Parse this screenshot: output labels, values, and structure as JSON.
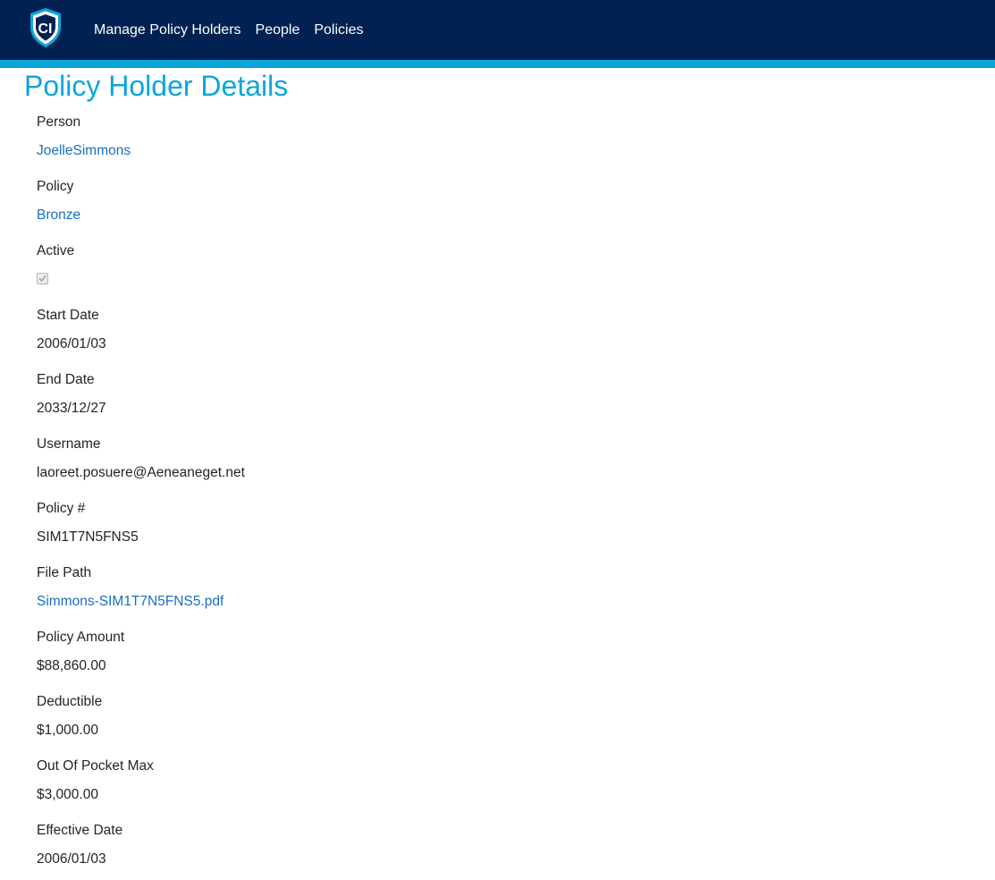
{
  "nav": {
    "logo_text": "CI",
    "links": [
      "Manage Policy Holders",
      "People",
      "Policies"
    ]
  },
  "page": {
    "title": "Policy Holder Details"
  },
  "fields": [
    {
      "label": "Person",
      "value": "JoelleSimmons",
      "type": "link"
    },
    {
      "label": "Policy",
      "value": "Bronze",
      "type": "link"
    },
    {
      "label": "Active",
      "value": true,
      "type": "checkbox"
    },
    {
      "label": "Start Date",
      "value": "2006/01/03",
      "type": "text"
    },
    {
      "label": "End Date",
      "value": "2033/12/27",
      "type": "text"
    },
    {
      "label": "Username",
      "value": "laoreet.posuere@Aeneaneget.net",
      "type": "text"
    },
    {
      "label": "Policy #",
      "value": "SIM1T7N5FNS5",
      "type": "text"
    },
    {
      "label": "File Path",
      "value": "Simmons-SIM1T7N5FNS5.pdf",
      "type": "link"
    },
    {
      "label": "Policy Amount",
      "value": "$88,860.00",
      "type": "text"
    },
    {
      "label": "Deductible",
      "value": "$1,000.00",
      "type": "text"
    },
    {
      "label": "Out Of Pocket Max",
      "value": "$3,000.00",
      "type": "text"
    },
    {
      "label": "Effective Date",
      "value": "2006/01/03",
      "type": "text"
    }
  ],
  "colors": {
    "navbar": "#002152",
    "accent": "#0ba5db",
    "link": "#1b6ec2"
  }
}
